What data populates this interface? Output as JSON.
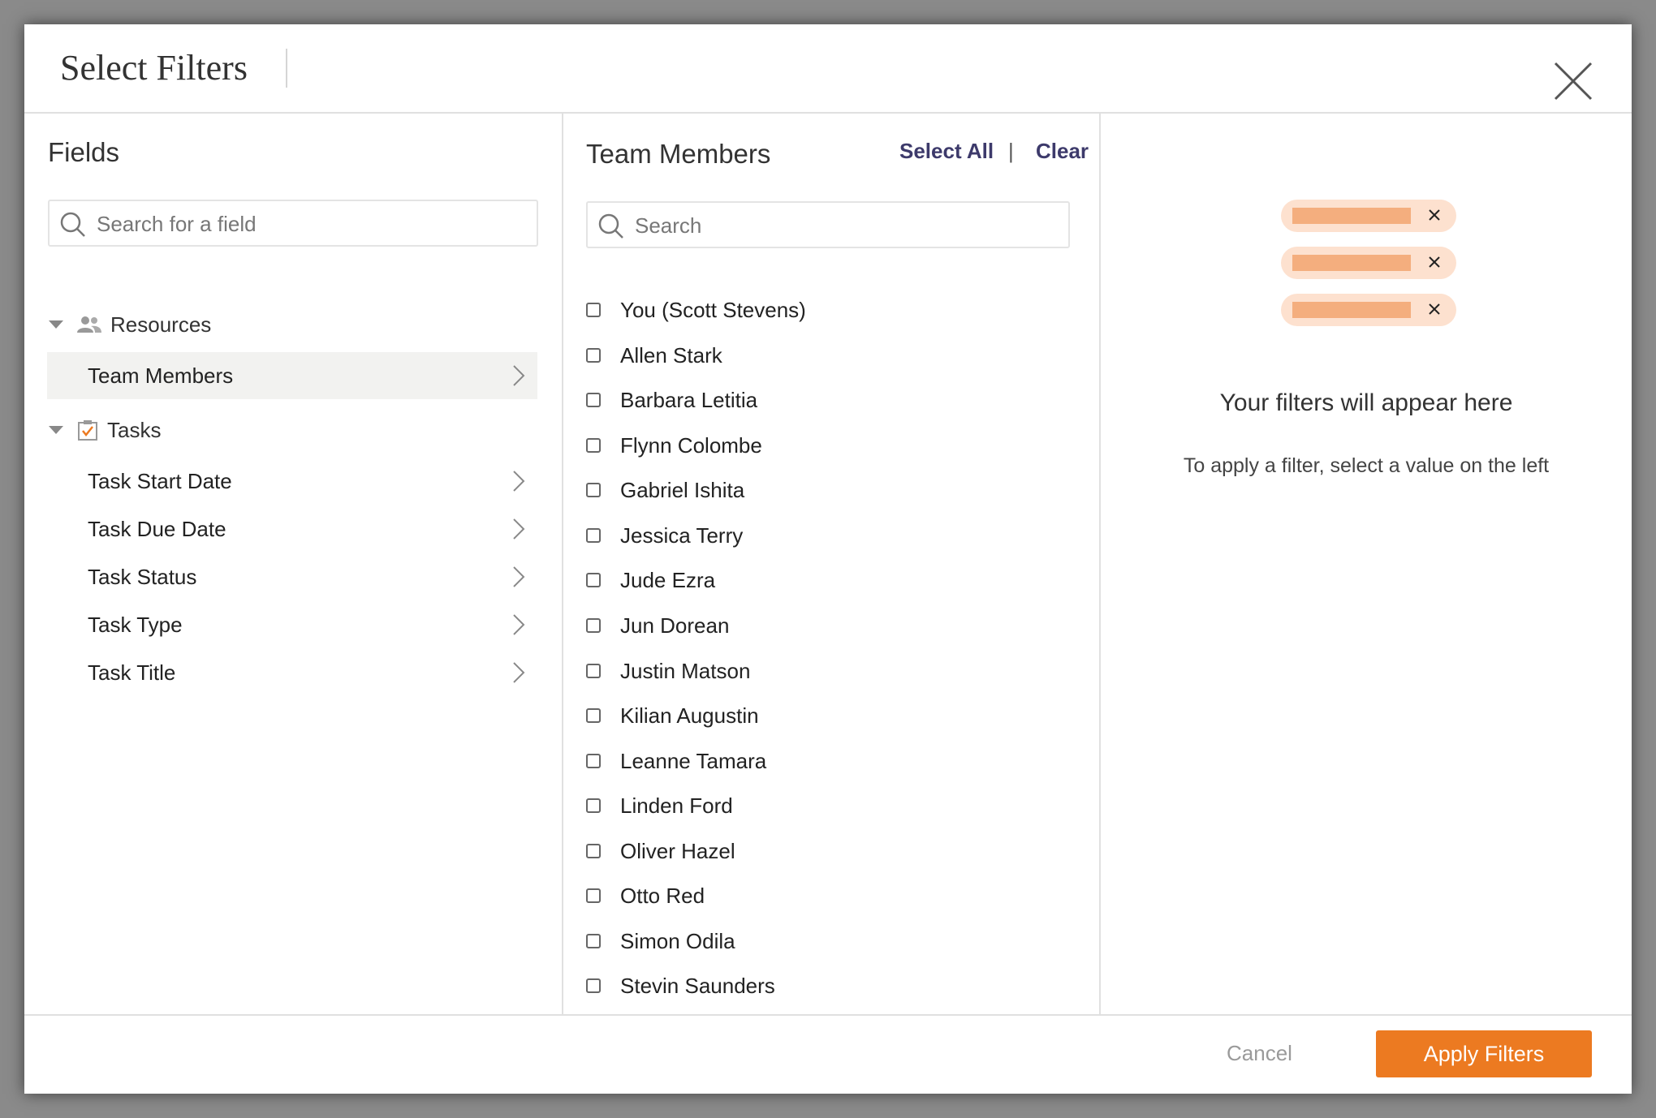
{
  "dialog": {
    "title": "Select Filters"
  },
  "fields_panel": {
    "heading": "Fields",
    "search_placeholder": "Search for a field",
    "groups": [
      {
        "label": "Resources",
        "icon": "people-icon",
        "items": [
          {
            "label": "Team Members",
            "active": true
          }
        ]
      },
      {
        "label": "Tasks",
        "icon": "task-checkbox-icon",
        "items": [
          {
            "label": "Task Start Date"
          },
          {
            "label": "Task Due Date"
          },
          {
            "label": "Task Status"
          },
          {
            "label": "Task Type"
          },
          {
            "label": "Task Title"
          }
        ]
      }
    ]
  },
  "members_panel": {
    "heading": "Team Members",
    "select_all": "Select All",
    "separator": "|",
    "clear": "Clear",
    "search_placeholder": "Search",
    "members": [
      "You (Scott Stevens)",
      "Allen Stark",
      "Barbara Letitia",
      "Flynn Colombe",
      "Gabriel Ishita",
      "Jessica Terry",
      "Jude Ezra",
      "Jun Dorean",
      "Justin Matson",
      "Kilian Augustin",
      "Leanne Tamara",
      "Linden Ford",
      "Oliver Hazel",
      "Otto Red",
      "Simon Odila",
      "Stevin Saunders"
    ]
  },
  "filters_panel": {
    "empty_title": "Your filters will appear here",
    "empty_subtitle": "To apply a filter, select a value on the left"
  },
  "footer": {
    "cancel_label": "Cancel",
    "apply_label": "Apply Filters"
  },
  "colors": {
    "accent": "#ec7a21",
    "link": "#3d3a6b",
    "chip_bg": "#fde1cf",
    "chip_bar": "#f4ae7e"
  }
}
